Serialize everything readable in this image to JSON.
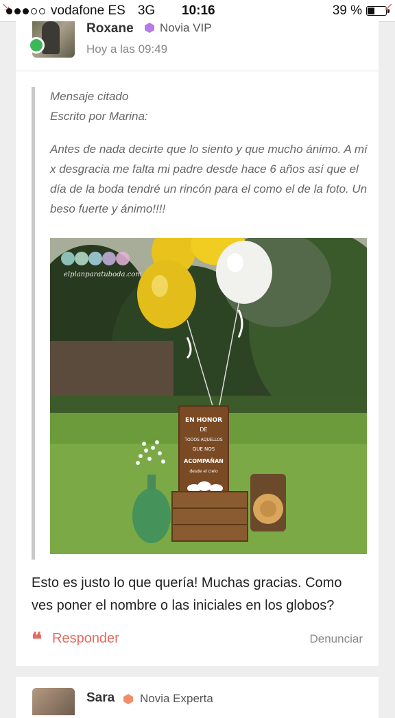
{
  "status_bar": {
    "carrier": "vodafone ES",
    "network": "3G",
    "time": "10:16",
    "battery": "39 %",
    "battery_level": 0.39,
    "signal_bars_filled": 3,
    "signal_bars_total": 5
  },
  "post": {
    "author": "Roxane",
    "role": "Novia VIP",
    "role_color": "#b57bea",
    "timestamp": "Hoy a las 09:49",
    "quote": {
      "title": "Mensaje citado",
      "author_line": "Escrito por Marina:",
      "text": "Antes de nada decirte que lo siento y que mucho ánimo. A mí x desgracia me falta mi padre desde hace 6 años así que el día de la boda tendré un rincón para el como el de la foto. Un beso fuerte y ánimo!!!!",
      "image": {
        "watermark": "elplanparatuboda.com",
        "sign_lines": [
          "EN HONOR",
          "DE",
          "TODOS AQUELLOS",
          "QUE NOS",
          "ACOMPAÑAN",
          "desde el cielo"
        ]
      }
    },
    "reply_text": "Esto es justo lo que quería! Muchas gracias. Como ves poner el nombre o las iniciales en los globos?",
    "respond_label": "Responder",
    "report_label": "Denunciar",
    "accent_color": "#e66a5f"
  },
  "next_post": {
    "author": "Sara",
    "role": "Novia Experta",
    "role_color": "#f08d6a"
  }
}
